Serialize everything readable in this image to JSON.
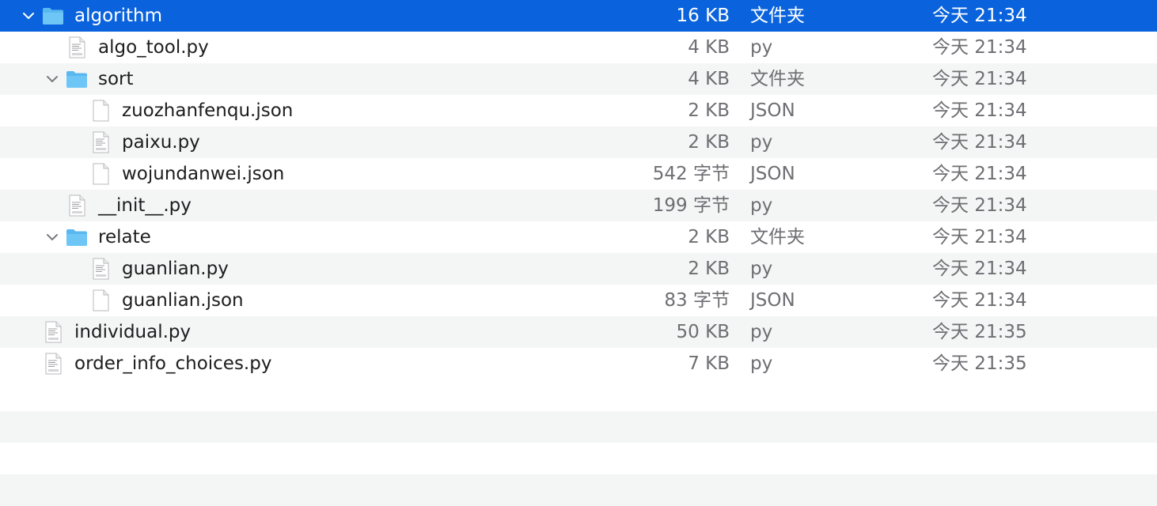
{
  "files": [
    {
      "name": "algorithm",
      "size": "16 KB",
      "kind": "文件夹",
      "date": "今天 21:34",
      "type": "folder",
      "expanded": true,
      "selected": true,
      "depth": 0
    },
    {
      "name": "algo_tool.py",
      "size": "4 KB",
      "kind": "py",
      "date": "今天 21:34",
      "type": "python",
      "depth": 1
    },
    {
      "name": "sort",
      "size": "4 KB",
      "kind": "文件夹",
      "date": "今天 21:34",
      "type": "folder",
      "expanded": true,
      "depth": 1
    },
    {
      "name": "zuozhanfenqu.json",
      "size": "2 KB",
      "kind": "JSON",
      "date": "今天 21:34",
      "type": "file",
      "depth": 2
    },
    {
      "name": "paixu.py",
      "size": "2 KB",
      "kind": "py",
      "date": "今天 21:34",
      "type": "python",
      "depth": 2
    },
    {
      "name": "wojundanwei.json",
      "size": "542 字节",
      "kind": "JSON",
      "date": "今天 21:34",
      "type": "file",
      "depth": 2
    },
    {
      "name": "__init__.py",
      "size": "199 字节",
      "kind": "py",
      "date": "今天 21:34",
      "type": "python",
      "depth": 1
    },
    {
      "name": "relate",
      "size": "2 KB",
      "kind": "文件夹",
      "date": "今天 21:34",
      "type": "folder",
      "expanded": true,
      "depth": 1
    },
    {
      "name": "guanlian.py",
      "size": "2 KB",
      "kind": "py",
      "date": "今天 21:34",
      "type": "python",
      "depth": 2
    },
    {
      "name": "guanlian.json",
      "size": "83 字节",
      "kind": "JSON",
      "date": "今天 21:34",
      "type": "file",
      "depth": 2
    },
    {
      "name": "individual.py",
      "size": "50 KB",
      "kind": "py",
      "date": "今天 21:35",
      "type": "python",
      "depth": 0
    },
    {
      "name": "order_info_choices.py",
      "size": "7 KB",
      "kind": "py",
      "date": "今天 21:35",
      "type": "python",
      "depth": 0
    }
  ],
  "colors": {
    "selection": "#0a63dc",
    "folder": "#5ab8f0",
    "stripe": "#f4f5f5",
    "secondary_text": "#6e6e73"
  },
  "icons": {
    "folder": "folder-icon",
    "python": "python-file-icon",
    "file": "file-icon",
    "disclosure": "chevron-down-icon"
  }
}
